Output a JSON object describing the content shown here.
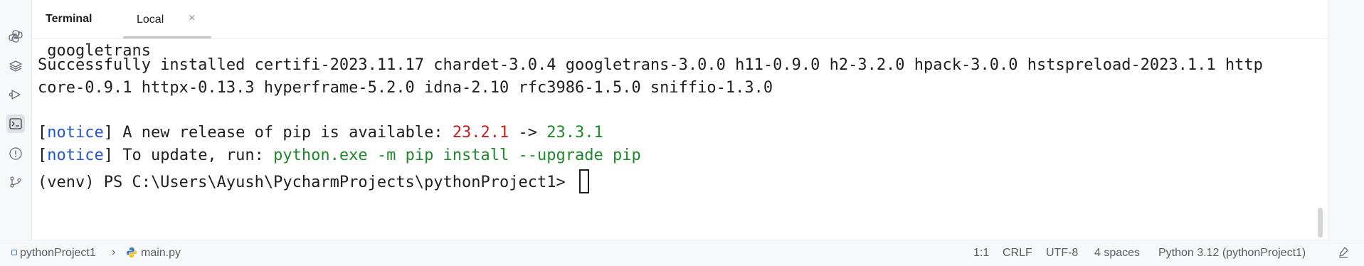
{
  "toolwindow": {
    "title": "Terminal",
    "tabs": [
      {
        "label": "Local",
        "close_glyph": "×",
        "active": true
      }
    ]
  },
  "leftbar": {
    "icons": [
      "python-console-icon",
      "layers-icon",
      "services-icon",
      "terminal-icon",
      "problems-icon",
      "git-icon"
    ],
    "active": "terminal-icon"
  },
  "terminal": {
    "line1": " googletrans",
    "line2": "Successfully installed certifi-2023.11.17 chardet-3.0.4 googletrans-3.0.0 h11-0.9.0 h2-3.2.0 hpack-3.0.0 hstspreload-2023.1.1 http",
    "line3": "core-0.9.1 httpx-0.13.3 hyperframe-5.2.0 idna-2.10 rfc3986-1.5.0 sniffio-1.3.0",
    "notice1": {
      "bracket_open": "[",
      "tag": "notice",
      "bracket_close": "]",
      "text": " A new release of pip is available: ",
      "old_version": "23.2.1",
      "arrow": " -> ",
      "new_version": "23.3.1"
    },
    "notice2": {
      "bracket_open": "[",
      "tag": "notice",
      "bracket_close": "]",
      "text": " To update, run: ",
      "command": "python.exe -m pip install --upgrade pip"
    },
    "prompt": "(venv) PS C:\\Users\\Ayush\\PycharmProjects\\pythonProject1> "
  },
  "statusbar": {
    "project": "pythonProject1",
    "separator": "›",
    "file": "main.py",
    "position": "1:1",
    "line_ending": "CRLF",
    "encoding": "UTF-8",
    "indent": "4 spaces",
    "interpreter": "Python 3.12 (pythonProject1)"
  },
  "colors": {
    "notice_tag": "#2454d6",
    "old_version": "#c81e1e",
    "new_version": "#1d8a2a",
    "command": "#1d8a2a"
  }
}
